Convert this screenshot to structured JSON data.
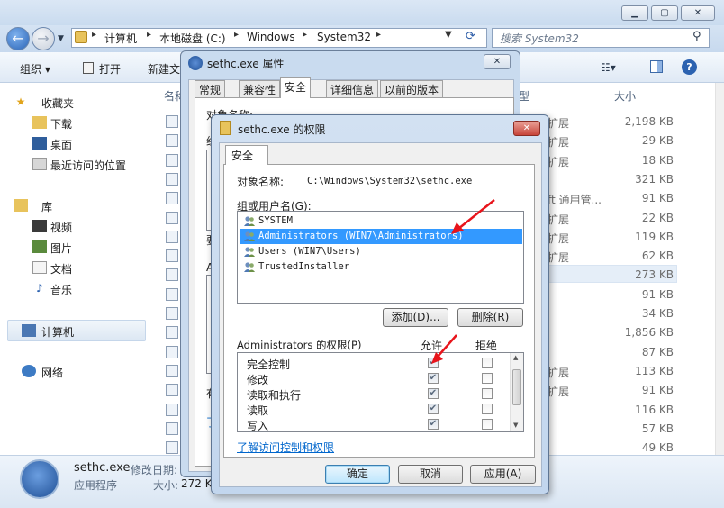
{
  "explorer": {
    "breadcrumbs": [
      "计算机",
      "本地磁盘 (C:)",
      "Windows",
      "System32"
    ],
    "search_placeholder": "搜索 System32",
    "toolbar": {
      "organize": "组织 ▾",
      "open": "打开",
      "new_folder": "新建文"
    },
    "nav": {
      "favorites": "收藏夹",
      "downloads": "下载",
      "desktop": "桌面",
      "recent": "最近访问的位置",
      "libraries": "库",
      "videos": "视频",
      "pictures": "图片",
      "documents": "文档",
      "music": "音乐",
      "computer": "计算机",
      "network": "网络"
    },
    "columns": {
      "name": "名称",
      "type": "型",
      "size": "大小"
    },
    "rows": [
      {
        "type": "扩展",
        "size": "2,198 KB"
      },
      {
        "type": "扩展",
        "size": "29 KB"
      },
      {
        "type": "扩展",
        "size": "18 KB"
      },
      {
        "type": "",
        "size": "321 KB"
      },
      {
        "type": "ft 通用管...",
        "size": "91 KB"
      },
      {
        "type": "扩展",
        "size": "22 KB"
      },
      {
        "type": "扩展",
        "size": "119 KB"
      },
      {
        "type": "扩展",
        "size": "62 KB"
      },
      {
        "type": "",
        "size": "273 KB"
      },
      {
        "type": "",
        "size": "91 KB"
      },
      {
        "type": "",
        "size": "34 KB"
      },
      {
        "type": "",
        "size": "1,856 KB"
      },
      {
        "type": "",
        "size": "87 KB"
      },
      {
        "type": "扩展",
        "size": "113 KB"
      },
      {
        "type": "扩展",
        "size": "91 KB"
      },
      {
        "type": "",
        "size": "116 KB"
      },
      {
        "type": "",
        "size": "57 KB"
      },
      {
        "type": "",
        "size": "49 KB"
      },
      {
        "type": "扩展",
        "size": ""
      }
    ],
    "details": {
      "filename": "sethc.exe",
      "modified_label": "修改日期:",
      "kind": "应用程序",
      "size_label": "大小:",
      "size_value": "272 K"
    }
  },
  "properties": {
    "title": "sethc.exe 属性",
    "close": "✕",
    "tabs": [
      "常规",
      "兼容性",
      "安全",
      "详细信息",
      "以前的版本"
    ],
    "active_tab": "安全",
    "ghost": {
      "obj": "对象名称:",
      "path": "C:\\Windows\\System32\\seth",
      "group_prefix": "组",
      "req_prefix": "要",
      "adv_prefix": "A",
      "extra": "有",
      "link_prefix": "了"
    }
  },
  "permissions": {
    "title": "sethc.exe 的权限",
    "close": "✕",
    "tab": "安全",
    "object_label": "对象名称:",
    "object_value": "C:\\Windows\\System32\\sethc.exe",
    "groups_label": "组或用户名(G):",
    "groups": [
      "SYSTEM",
      "Administrators (WIN7\\Administrators)",
      "Users (WIN7\\Users)",
      "TrustedInstaller"
    ],
    "selected_group_index": 1,
    "add_button": "添加(D)...",
    "remove_button": "删除(R)",
    "perm_label": "Administrators 的权限(P)",
    "allow_label": "允许",
    "deny_label": "拒绝",
    "perms": [
      {
        "name": "完全控制",
        "allow": true,
        "deny": false
      },
      {
        "name": "修改",
        "allow": true,
        "deny": false
      },
      {
        "name": "读取和执行",
        "allow": true,
        "deny": false
      },
      {
        "name": "读取",
        "allow": true,
        "deny": false
      },
      {
        "name": "写入",
        "allow": true,
        "deny": false
      }
    ],
    "learn_link": "了解访问控制和权限",
    "ok_button": "确定",
    "cancel_button": "取消",
    "apply_button": "应用(A)"
  },
  "colors": {
    "selection": "#3399ff",
    "annotation_arrow": "#e8141b",
    "link": "#0066cc"
  }
}
